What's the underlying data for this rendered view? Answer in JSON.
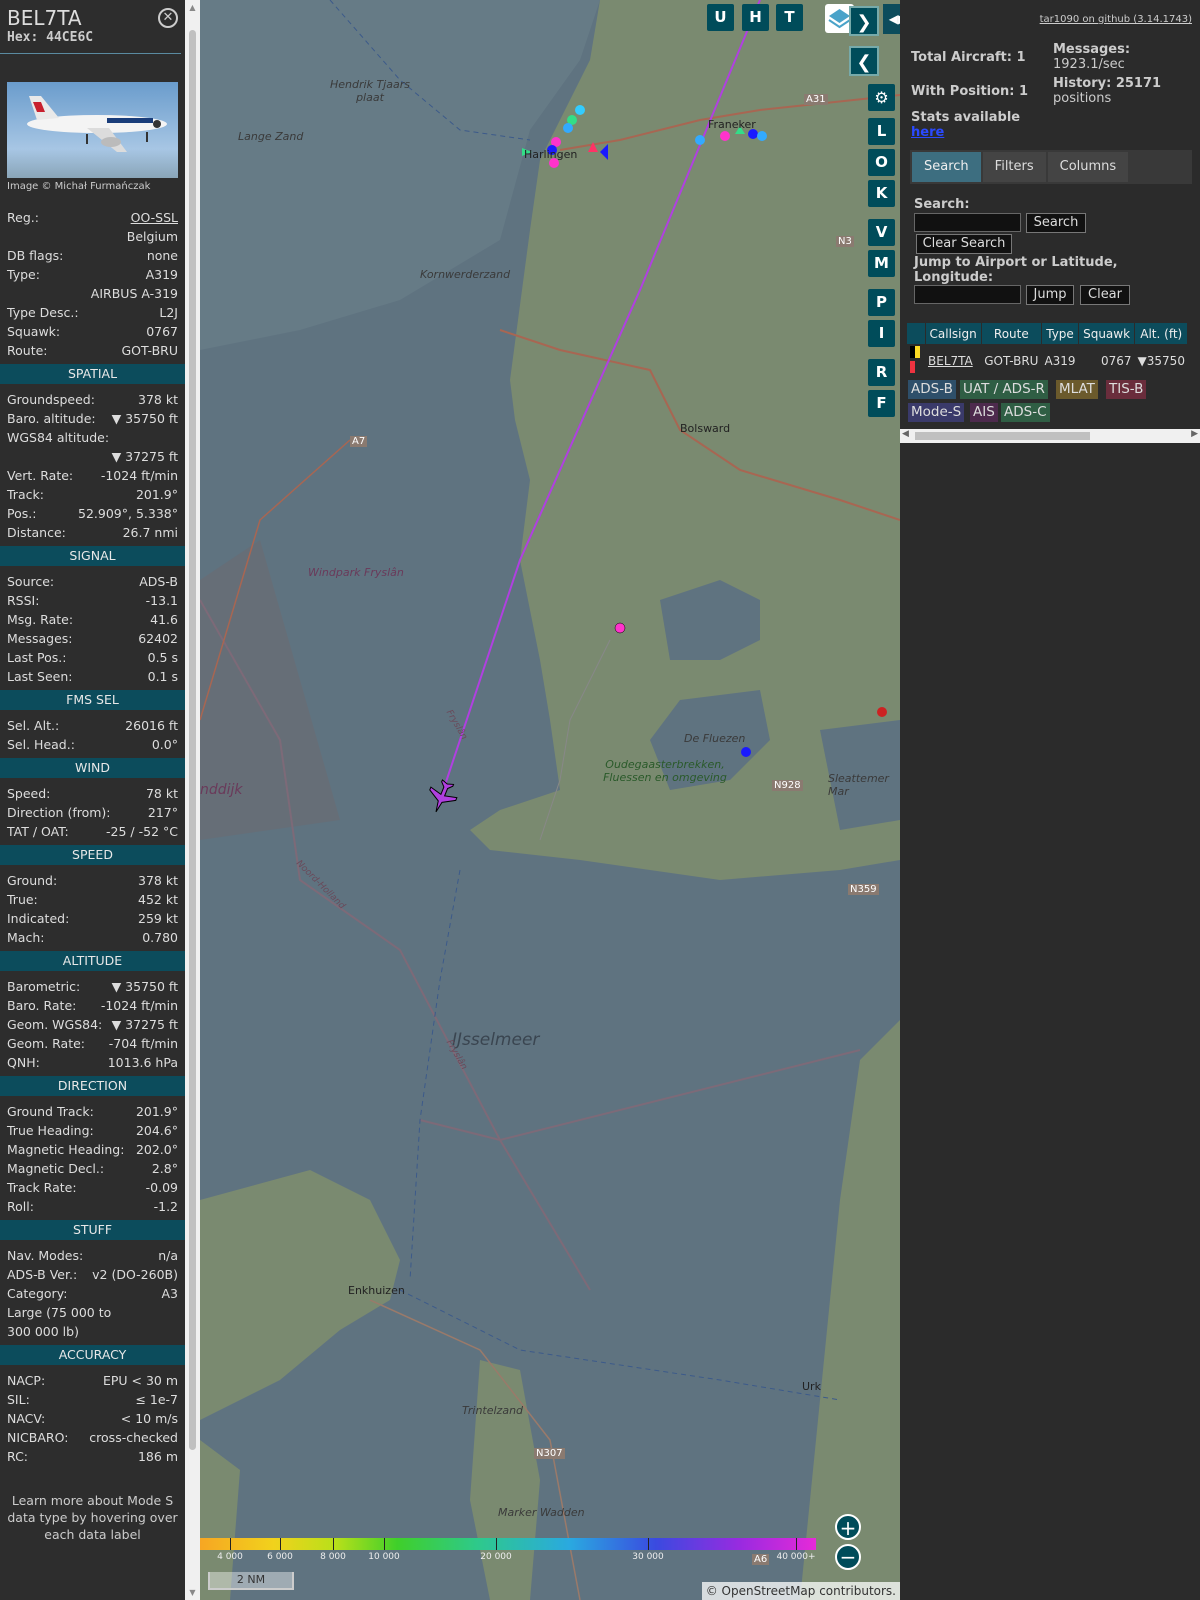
{
  "aircraft": {
    "callsign": "BEL7TA",
    "hex": "Hex: 44CE6C",
    "image_credit": "Image © Michał Furmańczak"
  },
  "info": [
    {
      "k": "Reg.:",
      "v": "OO-SSL"
    },
    {
      "k": "",
      "v": "Belgium"
    },
    {
      "k": "DB flags:",
      "v": "none"
    },
    {
      "k": "Type:",
      "v": "A319"
    },
    {
      "k": "",
      "v": "AIRBUS A-319"
    },
    {
      "k": "Type Desc.:",
      "v": "L2J"
    },
    {
      "k": "Squawk:",
      "v": "0767"
    },
    {
      "k": "Route:",
      "v": "GOT-BRU"
    }
  ],
  "sections": [
    {
      "title": "SPATIAL",
      "rows": [
        {
          "k": "Groundspeed:",
          "v": "378 kt"
        },
        {
          "k": "Baro. altitude:",
          "v": "▼ 35750 ft"
        },
        {
          "k": "WGS84 altitude:",
          "v": ""
        },
        {
          "k": "",
          "v": "▼ 37275 ft"
        },
        {
          "k": "Vert. Rate:",
          "v": "-1024 ft/min"
        },
        {
          "k": "Track:",
          "v": "201.9°"
        },
        {
          "k": "Pos.:",
          "v": "52.909°, 5.338°"
        },
        {
          "k": "Distance:",
          "v": "26.7 nmi"
        }
      ]
    },
    {
      "title": "SIGNAL",
      "rows": [
        {
          "k": "Source:",
          "v": "ADS-B"
        },
        {
          "k": "RSSI:",
          "v": "-13.1"
        },
        {
          "k": "Msg. Rate:",
          "v": "41.6"
        },
        {
          "k": "Messages:",
          "v": "62402"
        },
        {
          "k": "Last Pos.:",
          "v": "0.5 s"
        },
        {
          "k": "Last Seen:",
          "v": "0.1 s"
        }
      ]
    },
    {
      "title": "FMS SEL",
      "rows": [
        {
          "k": "Sel. Alt.:",
          "v": "26016 ft"
        },
        {
          "k": "Sel. Head.:",
          "v": "0.0°"
        }
      ]
    },
    {
      "title": "WIND",
      "rows": [
        {
          "k": "Speed:",
          "v": "78 kt"
        },
        {
          "k": "Direction (from):",
          "v": "217°"
        },
        {
          "k": "TAT / OAT:",
          "v": "-25 / -52 °C"
        }
      ]
    },
    {
      "title": "SPEED",
      "rows": [
        {
          "k": "Ground:",
          "v": "378 kt"
        },
        {
          "k": "True:",
          "v": "452 kt"
        },
        {
          "k": "Indicated:",
          "v": "259 kt"
        },
        {
          "k": "Mach:",
          "v": "0.780"
        }
      ]
    },
    {
      "title": "ALTITUDE",
      "rows": [
        {
          "k": "Barometric:",
          "v": "▼ 35750 ft"
        },
        {
          "k": "Baro. Rate:",
          "v": "-1024 ft/min"
        },
        {
          "k": "Geom. WGS84:",
          "v": "▼ 37275 ft"
        },
        {
          "k": "Geom. Rate:",
          "v": "-704 ft/min"
        },
        {
          "k": "QNH:",
          "v": "1013.6 hPa"
        }
      ]
    },
    {
      "title": "DIRECTION",
      "rows": [
        {
          "k": "Ground Track:",
          "v": "201.9°"
        },
        {
          "k": "True Heading:",
          "v": "204.6°"
        },
        {
          "k": "Magnetic Heading:",
          "v": "202.0°"
        },
        {
          "k": "Magnetic Decl.:",
          "v": "2.8°"
        },
        {
          "k": "Track Rate:",
          "v": "-0.09"
        },
        {
          "k": "Roll:",
          "v": "-1.2"
        }
      ]
    },
    {
      "title": "STUFF",
      "rows": [
        {
          "k": "Nav. Modes:",
          "v": "n/a"
        },
        {
          "k": "ADS-B Ver.:",
          "v": "v2 (DO-260B)"
        },
        {
          "k": "Category:",
          "v": "A3"
        },
        {
          "k": "Large (75 000 to",
          "v": ""
        },
        {
          "k": "300 000 lb)",
          "v": ""
        }
      ]
    },
    {
      "title": "ACCURACY",
      "rows": [
        {
          "k": "NACP:",
          "v": "EPU < 30 m"
        },
        {
          "k": "SIL:",
          "v": "≤ 1e-7"
        },
        {
          "k": "NACV:",
          "v": "< 10 m/s"
        },
        {
          "k": "NICBARO:",
          "v": "cross-checked"
        },
        {
          "k": "RC:",
          "v": "186 m"
        }
      ]
    }
  ],
  "footer": "Learn more about Mode S data type by hovering over each data label",
  "map": {
    "labels": [
      "Hendrik Tjaars plaat",
      "Lange Zand",
      "Harlingen",
      "Franeker",
      "Kornwerderzand",
      "Bolsward",
      "Windpark Fryslân",
      "Oudegaasterbrekken, Fluessen en omgeving",
      "De Fluezen",
      "Sleattemer Mar",
      "IJsselmeer",
      "Enkhuizen",
      "Urk",
      "Trintelzand",
      "Marker Wadden",
      "nddijk",
      "Fryslân",
      "Noord-Holland",
      "A31",
      "A7",
      "N3",
      "N928",
      "N359",
      "N307",
      "A6"
    ],
    "buttons": [
      "U",
      "H",
      "T",
      "L",
      "O",
      "K",
      "V",
      "M",
      "P",
      "I",
      "R",
      "F"
    ],
    "color_scale": [
      "4 000",
      "6 000",
      "8 000",
      "10 000",
      "20 000",
      "30 000",
      "40 000+"
    ],
    "scale": "2 NM",
    "attribution": "© OpenStreetMap contributors."
  },
  "stats": {
    "total": "Total Aircraft: 1",
    "position": "With Position: 1",
    "msgs_label": "Messages:",
    "msgs": "1923.1/sec",
    "hist_label": "History: 25171",
    "hist": "positions",
    "avail": "Stats available",
    "here": "here",
    "github": "tar1090 on github (3.14.1743)"
  },
  "tabs": [
    "Search",
    "Filters",
    "Columns"
  ],
  "search": {
    "label": "Search:",
    "btn": "Search",
    "clear": "Clear Search",
    "jump_label": "Jump to Airport or Latitude, Longitude:",
    "jump": "Jump",
    "jclear": "Clear"
  },
  "table": {
    "headers": [
      "",
      "Callsign",
      "Route",
      "Type",
      "Squawk",
      "Alt. (ft)"
    ],
    "row": [
      "",
      "BEL7TA",
      "GOT-BRU",
      "A319",
      "0767",
      "▼35750"
    ]
  },
  "sources": [
    {
      "t": "ADS-B",
      "c": "#2e4f6a"
    },
    {
      "t": "UAT / ADS-R",
      "c": "#2f5e44"
    },
    {
      "t": "MLAT",
      "c": "#6b5a2c"
    },
    {
      "t": "TIS-B",
      "c": "#6a2d3c"
    },
    {
      "t": "Mode-S",
      "c": "#3a3a6a"
    },
    {
      "t": "AIS",
      "c": "#4d2a4d"
    },
    {
      "t": "ADS-C",
      "c": "#2f5e44"
    }
  ]
}
